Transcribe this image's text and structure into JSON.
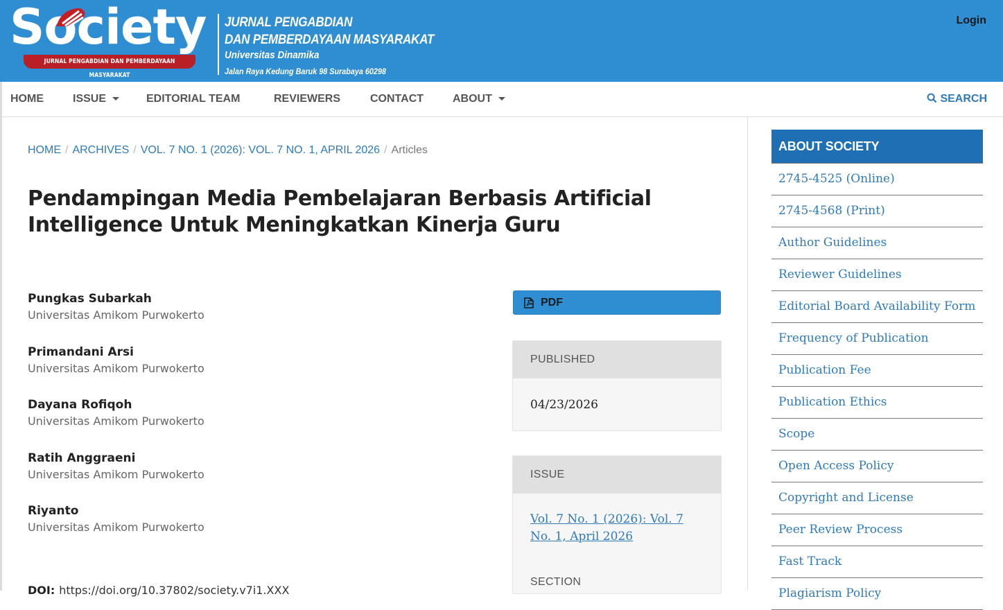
{
  "header": {
    "logo_text": "Society",
    "logo_ribbon": "JURNAL PENGABDIAN DAN PEMBERDAYAAN MASYARAKAT",
    "journal_line1": "JURNAL PENGABDIAN",
    "journal_line2": "DAN PEMBERDAYAAN MASYARAKAT",
    "journal_line3": "Universitas Dinamika",
    "journal_line4": "Jalan Raya Kedung Baruk 98 Surabaya 60298",
    "login_label": "Login",
    "bg_color": "#2f8dd1"
  },
  "nav": {
    "home": "HOME",
    "issue": "ISSUE",
    "editorial": "EDITORIAL TEAM",
    "reviewers": "REVIEWERS",
    "contact": "CONTACT",
    "about": "ABOUT",
    "search": "SEARCH"
  },
  "breadcrumb": {
    "home": "HOME",
    "archives": "ARCHIVES",
    "issue": "VOL. 7 NO. 1 (2026): VOL. 7 NO. 1, APRIL 2026",
    "current": "Articles",
    "separator": "/"
  },
  "article": {
    "title": "Pendampingan Media Pembelajaran Berbasis Artificial Intelligence Untuk Meningkatkan Kinerja Guru",
    "authors": [
      {
        "name": "Pungkas Subarkah",
        "affiliation": "Universitas Amikom Purwokerto"
      },
      {
        "name": "Primandani Arsi",
        "affiliation": "Universitas Amikom Purwokerto"
      },
      {
        "name": "Dayana Rofiqoh",
        "affiliation": "Universitas Amikom Purwokerto"
      },
      {
        "name": "Ratih Anggraeni",
        "affiliation": "Universitas Amikom Purwokerto"
      },
      {
        "name": "Riyanto",
        "affiliation": "Universitas Amikom Purwokerto"
      }
    ],
    "doi_label": "DOI:",
    "doi_url": "https://doi.org/10.37802/society.v7i1.XXX"
  },
  "details": {
    "pdf_label": "PDF",
    "published_label": "PUBLISHED",
    "published_date": "04/23/2026",
    "issue_label": "ISSUE",
    "issue_link": "Vol. 7 No. 1 (2026): Vol. 7 No. 1, April 2026",
    "section_label": "SECTION"
  },
  "sidebar": {
    "title": "ABOUT SOCIETY",
    "links": [
      "2745-4525 (Online)",
      "2745-4568 (Print)",
      "Author Guidelines",
      "Reviewer Guidelines",
      "Editorial Board Availability Form",
      "Frequency of Publication",
      "Publication Fee",
      "Publication Ethics",
      "Scope",
      "Open Access Policy",
      "Copyright and License",
      "Peer Review Process",
      "Fast Track",
      "Plagiarism Policy"
    ]
  }
}
